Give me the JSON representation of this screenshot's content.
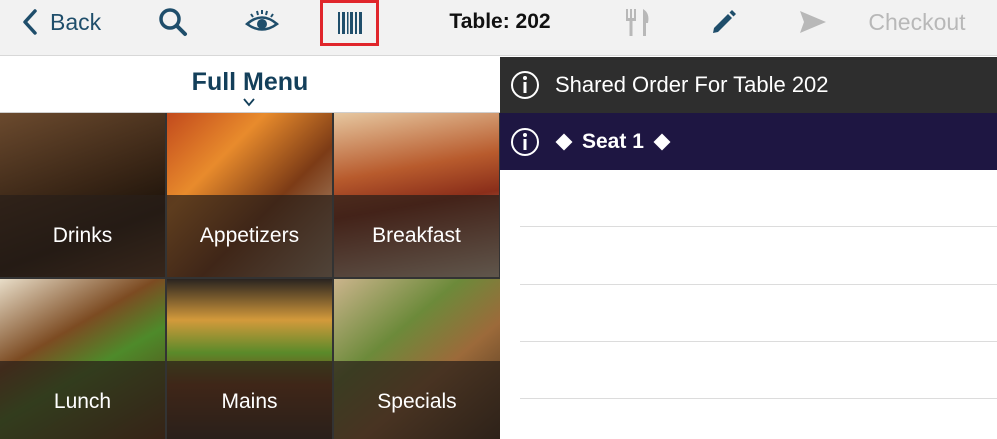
{
  "toolbar": {
    "back_label": "Back",
    "table_title": "Table: 202",
    "checkout_label": "Checkout",
    "icons": [
      "chevron-left-icon",
      "search-icon",
      "eye-icon",
      "barcode-icon",
      "fork-knife-icon",
      "pencil-icon",
      "send-icon"
    ],
    "colors": {
      "accent": "#1f4e6b",
      "highlight_border": "#e0262b",
      "disabled": "#b8b8b8"
    }
  },
  "menu": {
    "title": "Full Menu",
    "categories": [
      {
        "label": "Drinks"
      },
      {
        "label": "Appetizers"
      },
      {
        "label": "Breakfast"
      },
      {
        "label": "Lunch"
      },
      {
        "label": "Mains"
      },
      {
        "label": "Specials"
      }
    ]
  },
  "order": {
    "shared_title": "Shared Order For Table 202",
    "seat_label": "Seat 1",
    "colors": {
      "header_bg": "#2e2e2e",
      "seat_bg": "#1e1642"
    }
  }
}
